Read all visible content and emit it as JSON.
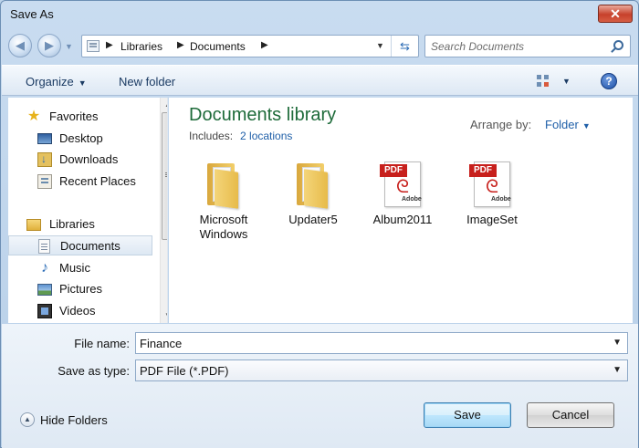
{
  "window": {
    "title": "Save As",
    "close_label": "✕"
  },
  "address": {
    "crumbs": [
      "Libraries",
      "Documents"
    ],
    "search_placeholder": "Search Documents"
  },
  "toolbar": {
    "organize": "Organize",
    "new_folder": "New folder",
    "help": "?"
  },
  "nav": {
    "favorites": "Favorites",
    "favorite_items": [
      "Desktop",
      "Downloads",
      "Recent Places"
    ],
    "libraries": "Libraries",
    "library_items": [
      "Documents",
      "Music",
      "Pictures",
      "Videos"
    ],
    "selected": "Documents"
  },
  "content": {
    "title": "Documents library",
    "includes_label": "Includes:",
    "includes_link": "2 locations",
    "arrange_label": "Arrange by:",
    "arrange_value": "Folder",
    "items": [
      {
        "name": "Microsoft Windows",
        "type": "folder"
      },
      {
        "name": "Updater5",
        "type": "folder"
      },
      {
        "name": "Album2011",
        "type": "pdf"
      },
      {
        "name": "ImageSet",
        "type": "pdf"
      }
    ],
    "pdf_tag": "PDF",
    "pdf_brand": "Adobe"
  },
  "form": {
    "file_name_label": "File name:",
    "file_name_value": "Finance",
    "save_type_label": "Save as type:",
    "save_type_value": "PDF File (*.PDF)"
  },
  "footer": {
    "hide_folders": "Hide Folders",
    "save": "Save",
    "cancel": "Cancel"
  },
  "colors": {
    "library_title": "#1e6b3a",
    "link": "#1f5fa8",
    "close": "#c7412b"
  }
}
